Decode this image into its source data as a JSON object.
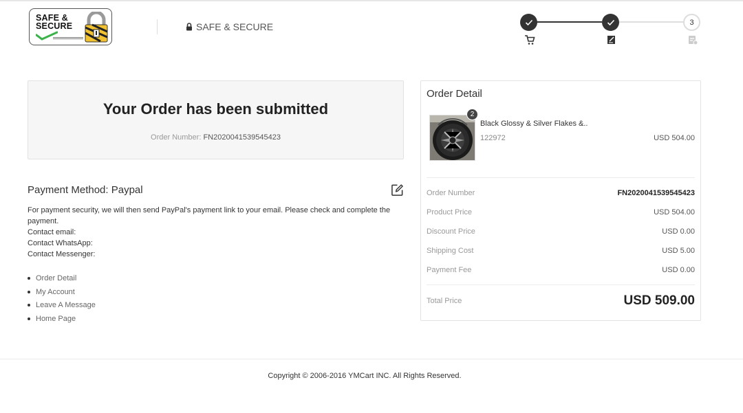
{
  "header": {
    "logo_text_line1": "SAFE &",
    "logo_text_line2": "SECURE",
    "secure_label": "SAFE & SECURE",
    "steps": [
      {
        "state": "done",
        "icon": "cart-icon"
      },
      {
        "state": "done",
        "icon": "edit-document-icon"
      },
      {
        "state": "current",
        "number": "3",
        "icon": "receipt-icon"
      }
    ]
  },
  "submitted": {
    "title": "Your Order has been submitted",
    "order_number_label": "Order Number:",
    "order_number": "FN2020041539545423"
  },
  "payment": {
    "title": "Payment Method: Paypal",
    "message": "For payment security, we will then send PayPal's payment link to your email. Please check and complete the payment.",
    "contact_email": "Contact email:",
    "contact_whatsapp": "Contact WhatsApp:",
    "contact_messenger": "Contact Messenger:",
    "links": [
      "Order Detail",
      "My Account",
      "Leave A Message",
      "Home Page"
    ]
  },
  "order_detail": {
    "title": "Order Detail",
    "product": {
      "quantity": "2",
      "name": "Black Glossy & Silver Flakes &..",
      "sku": "122972",
      "price": "USD 504.00"
    },
    "rows": [
      {
        "label": "Order Number",
        "value": "FN2020041539545423"
      },
      {
        "label": "Product Price",
        "value": "USD 504.00"
      },
      {
        "label": "Discount Price",
        "value": "USD 0.00"
      },
      {
        "label": "Shipping Cost",
        "value": "USD 5.00"
      },
      {
        "label": "Payment Fee",
        "value": "USD 0.00"
      }
    ],
    "total_label": "Total Price",
    "total_value": "USD 509.00"
  },
  "footer": {
    "copyright": "Copyright © 2006-2016 YMCart INC. All Rights Reserved."
  },
  "colors": {
    "step_done": "#333333",
    "step_line_done": "#333333",
    "step_line_pending": "#dddddd",
    "panel_bg": "#f6f6f6"
  }
}
